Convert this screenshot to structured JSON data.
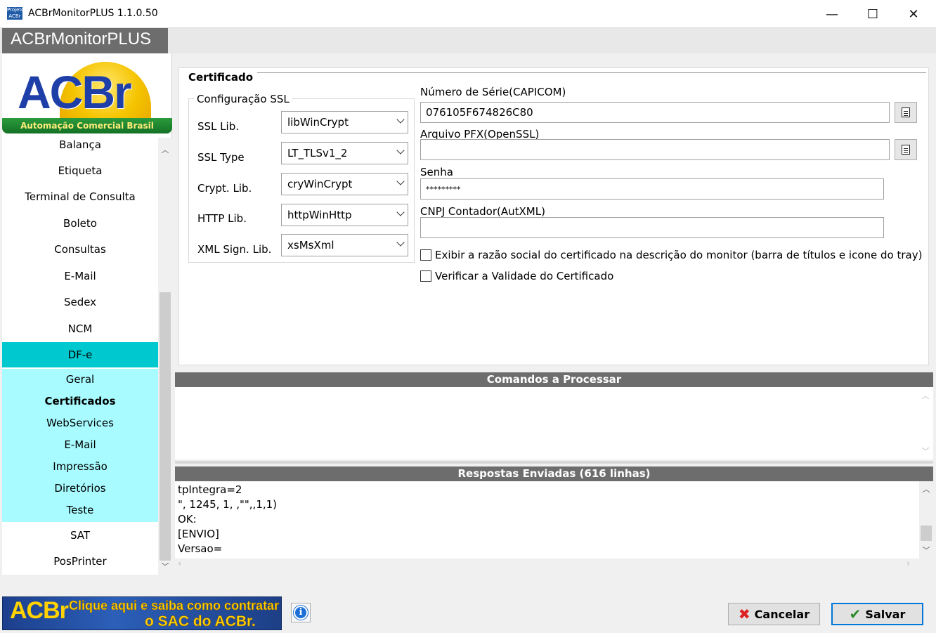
{
  "window": {
    "title": "ACBrMonitorPLUS 1.1.0.50",
    "icon_text": "Projeto ACBr",
    "minimize_glyph": "—",
    "maximize_glyph": "☐",
    "close_glyph": "✕"
  },
  "brand_tab": "ACBrMonitorPLUS",
  "logo": {
    "text": "ACBr",
    "tagline": "Automação Comercial Brasil"
  },
  "sidebar": {
    "items": [
      {
        "label": "Balança"
      },
      {
        "label": "Etiqueta"
      },
      {
        "label": "Terminal de Consulta"
      },
      {
        "label": "Boleto"
      },
      {
        "label": "Consultas"
      },
      {
        "label": "E-Mail"
      },
      {
        "label": "Sedex"
      },
      {
        "label": "NCM"
      },
      {
        "label": "DF-e"
      }
    ],
    "subitems": [
      {
        "label": "Geral"
      },
      {
        "label": "Certificados"
      },
      {
        "label": "WebServices"
      },
      {
        "label": "E-Mail"
      },
      {
        "label": "Impressão"
      },
      {
        "label": "Diretórios"
      },
      {
        "label": "Teste"
      }
    ],
    "after_items": [
      {
        "label": "SAT"
      },
      {
        "label": "PosPrinter"
      }
    ]
  },
  "certificado": {
    "title": "Certificado",
    "ssl_group_title": "Configuração SSL",
    "ssl": [
      {
        "label": "SSL Lib.",
        "value": "libWinCrypt"
      },
      {
        "label": "SSL Type",
        "value": "LT_TLSv1_2"
      },
      {
        "label": "Crypt. Lib.",
        "value": "cryWinCrypt"
      },
      {
        "label": "HTTP Lib.",
        "value": "httpWinHttp"
      },
      {
        "label": "XML Sign. Lib.",
        "value": "xsMsXml"
      }
    ],
    "numero_serie_label": "Número de Série(CAPICOM)",
    "numero_serie_value": "076105F674826C80",
    "arquivo_pfx_label": "Arquivo PFX(OpenSSL)",
    "arquivo_pfx_value": "",
    "senha_label": "Senha",
    "senha_value": "*********",
    "cnpj_label": "CNPJ Contador(AutXML)",
    "cnpj_value": "",
    "check_razao_label": "Exibir a razão social do certificado na descrição do monitor (barra de títulos e icone do tray)",
    "check_validade_label": "Verificar a Validade do Certificado"
  },
  "comandos": {
    "title": "Comandos a Processar"
  },
  "respostas": {
    "title": "Respostas Enviadas (616 linhas)",
    "lines": [
      "tpIntegra=2",
      "\", 1245, 1, ,\"\",,1,1)",
      "OK:",
      "[ENVIO]",
      "Versao="
    ]
  },
  "footer": {
    "sac_logo": "ACBr",
    "sac_line1": "Clique aqui e saiba como contratar",
    "sac_line2": "o SAC do ACBr.",
    "info_glyph": "i",
    "cancel_label": "Cancelar",
    "save_label": "Salvar"
  }
}
